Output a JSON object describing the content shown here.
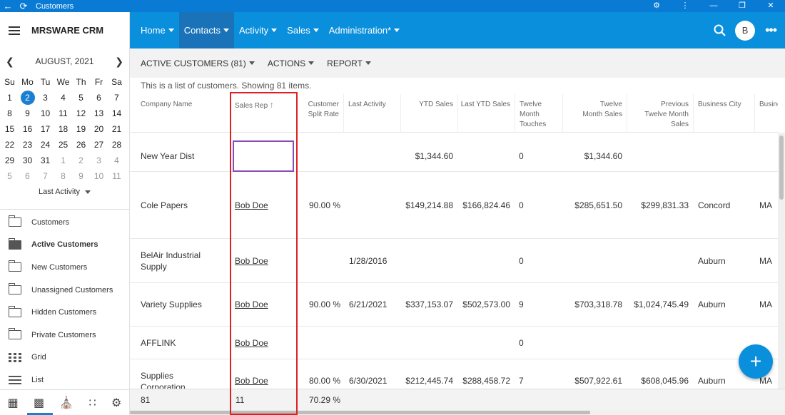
{
  "titlebar": {
    "title": "Customers"
  },
  "brand": {
    "name": "MRSWARE CRM"
  },
  "topnav": {
    "items": [
      "Home",
      "Contacts",
      "Activity",
      "Sales",
      "Administration*"
    ],
    "avatar": "B"
  },
  "calendar": {
    "month": "AUGUST, 2021",
    "weekdays": [
      "Su",
      "Mo",
      "Tu",
      "We",
      "Th",
      "Fr",
      "Sa"
    ],
    "days": [
      "1",
      "2",
      "3",
      "4",
      "5",
      "6",
      "7",
      "8",
      "9",
      "10",
      "11",
      "12",
      "13",
      "14",
      "15",
      "16",
      "17",
      "18",
      "19",
      "20",
      "21",
      "22",
      "23",
      "24",
      "25",
      "26",
      "27",
      "28",
      "29",
      "30",
      "31",
      "1",
      "2",
      "3",
      "4",
      "5",
      "6",
      "7",
      "8",
      "9",
      "10",
      "11"
    ],
    "selected_day": "2",
    "filter_label": "Last Activity"
  },
  "sidebar": {
    "items": [
      "Customers",
      "Active Customers",
      "New Customers",
      "Unassigned Customers",
      "Hidden Customers",
      "Private Customers",
      "Grid",
      "List"
    ],
    "active_item": "Active Customers"
  },
  "subnav": {
    "view_label": "ACTIVE CUSTOMERS (81)",
    "actions_label": "ACTIONS",
    "report_label": "REPORT"
  },
  "description": "This is a list of customers. Showing 81 items.",
  "table": {
    "columns": [
      "Company Name",
      "Sales Rep",
      "Customer Split Rate",
      "Last Activity",
      "YTD Sales",
      "Last YTD Sales",
      "Twelve Month Touches",
      "Twelve Month Sales",
      "Previous Twelve Month Sales",
      "Business City",
      "Busine"
    ],
    "rows": [
      [
        "New Year Dist",
        "",
        "",
        "",
        "$1,344.60",
        "",
        "0",
        "$1,344.60",
        "",
        "",
        ""
      ],
      [
        "Cole Papers",
        "Bob Doe",
        "90.00 %",
        "",
        "$149,214.88",
        "$166,824.46",
        "0",
        "$285,651.50",
        "$299,831.33",
        "Concord",
        "MA"
      ],
      [
        "BelAir Industrial Supply",
        "Bob Doe",
        "",
        "1/28/2016",
        "",
        "",
        "0",
        "",
        "",
        "Auburn",
        "MA"
      ],
      [
        "Variety Supplies",
        "Bob Doe",
        "90.00 %",
        "6/21/2021",
        "$337,153.07",
        "$502,573.00",
        "9",
        "$703,318.78",
        "$1,024,745.49",
        "Auburn",
        "MA"
      ],
      [
        "AFFLINK",
        "Bob Doe",
        "",
        "",
        "",
        "",
        "0",
        "",
        "",
        "",
        ""
      ],
      [
        "Supplies Corporation",
        "Bob Doe",
        "80.00 %",
        "6/30/2021",
        "$212,445.74",
        "$288,458.72",
        "7",
        "$507,922.61",
        "$608,045.96",
        "Auburn",
        "MA"
      ]
    ],
    "footer": [
      "81",
      "11",
      "70.29 %"
    ]
  },
  "fab_label": "+"
}
